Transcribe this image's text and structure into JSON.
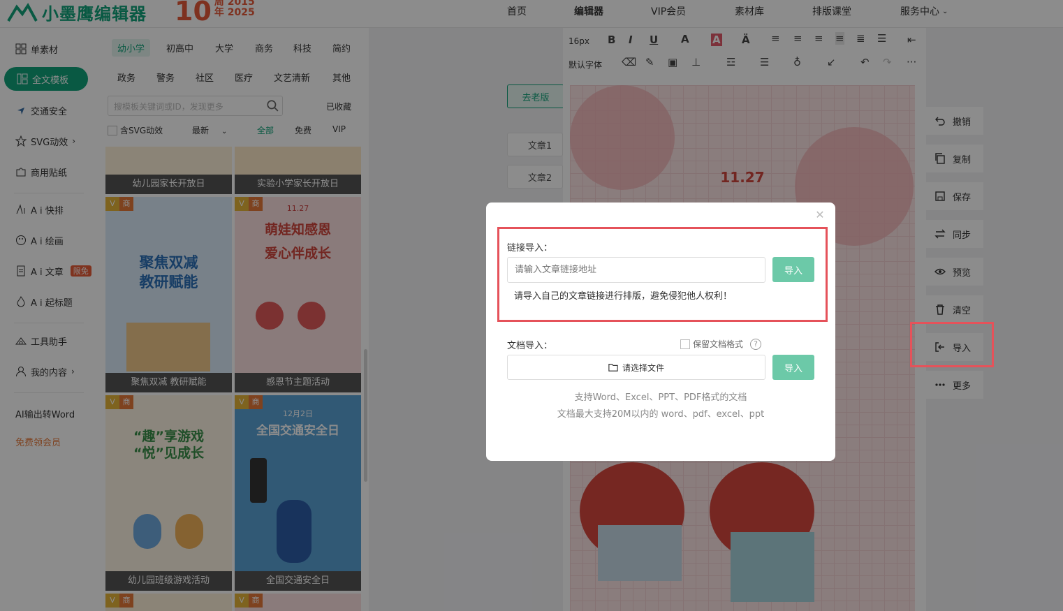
{
  "header": {
    "logo_text": "小墨鹰编辑器",
    "anniversary_number": "10",
    "anniversary_line1": "周 2015",
    "anniversary_line2": "年 2025",
    "nav": [
      "首页",
      "编辑器",
      "VIP会员",
      "素材库",
      "排版课堂",
      "服务中心"
    ]
  },
  "sidebar": {
    "items": [
      "单素材",
      "全文模板",
      "交通安全",
      "SVG动效",
      "商用贴纸",
      "A i 快排",
      "A i 绘画",
      "A i 文章",
      "A i 起标题",
      "工具助手",
      "我的内容",
      "AI输出转Word",
      "免费领会员"
    ],
    "badge": "限免"
  },
  "templates": {
    "categories_row1": [
      "幼小学",
      "初高中",
      "大学",
      "商务",
      "科技",
      "简约"
    ],
    "categories_row2": [
      "政务",
      "警务",
      "社区",
      "医疗",
      "文艺清新",
      "其他"
    ],
    "search_placeholder": "搜模板关键词或ID，发现更多",
    "favorites": "已收藏",
    "svg_filter": "含SVG动效",
    "sort": "最新",
    "price_tabs": [
      "全部",
      "免费",
      "VIP"
    ],
    "vip_tag": "V",
    "biz_tag": "商",
    "cards": [
      {
        "caption": "幼儿园家长开放日"
      },
      {
        "caption": "实验小学家长开放日"
      },
      {
        "caption": "聚焦双减 教研赋能",
        "title_a": "聚焦双减",
        "title_b": "教研赋能"
      },
      {
        "caption": "感恩节主题活动",
        "date": "11.27",
        "title_a": "萌娃知感恩",
        "title_b": "爱心伴成长"
      },
      {
        "caption": "幼儿园班级游戏活动",
        "title_a": "“趣”享游戏",
        "title_b": "“悦”见成长"
      },
      {
        "caption": "全国交通安全日",
        "date": "12月2日",
        "title_a": "全国交通安全日"
      }
    ]
  },
  "editor": {
    "font_size": "16px",
    "font_family": "默认字体",
    "old_version": "去老版",
    "articles": [
      "文章1",
      "文章2"
    ],
    "poster_date": "11.27"
  },
  "right_actions": [
    "撤销",
    "复制",
    "保存",
    "同步",
    "预览",
    "清空",
    "导入",
    "更多"
  ],
  "modal": {
    "link_label": "链接导入：",
    "link_placeholder": "请输入文章链接地址",
    "import_btn": "导入",
    "link_note": "请导入自己的文章链接进行排版，避免侵犯他人权利！",
    "doc_label": "文档导入：",
    "keep_format": "保留文档格式",
    "help": "?",
    "choose_file": "请选择文件",
    "hint1": "支持Word、Excel、PPT、PDF格式的文档",
    "hint2": "文档最大支持20M以内的 word、pdf、excel、ppt"
  }
}
